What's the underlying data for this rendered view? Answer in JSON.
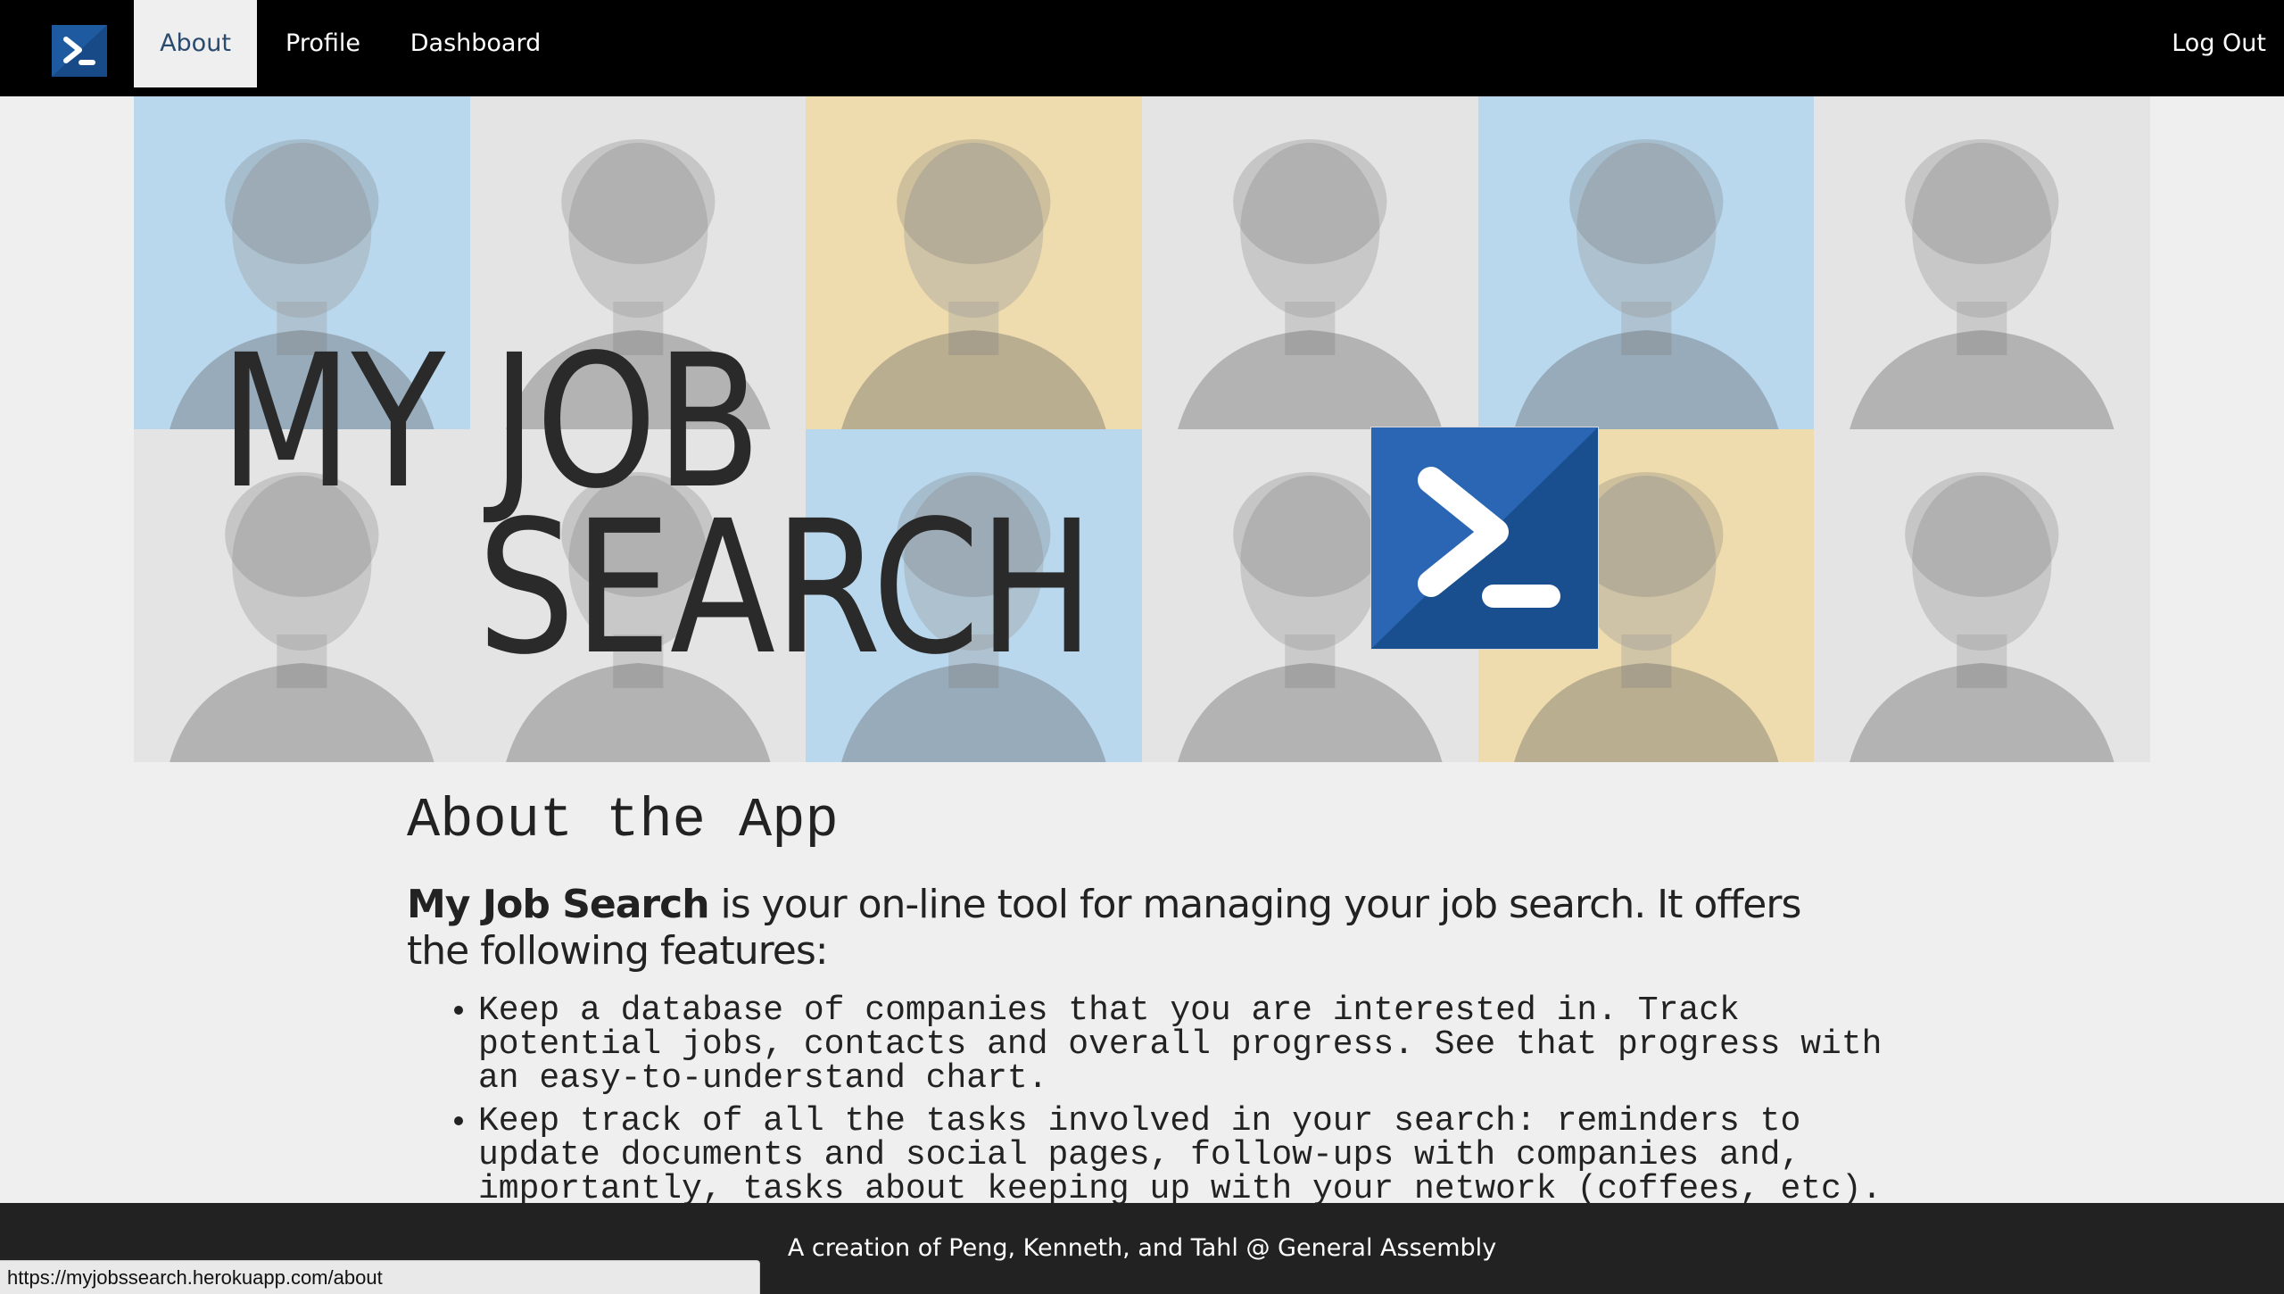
{
  "nav": {
    "about": "About",
    "profile": "Profile",
    "dashboard": "Dashboard",
    "logout": "Log Out",
    "active": "About"
  },
  "hero": {
    "title_line1": "MY  JOB",
    "title_line2": "SEARCH",
    "logo_icon": "powershell-prompt-icon"
  },
  "about": {
    "heading": "About the App",
    "intro_bold": "My Job Search",
    "intro_rest": " is your on-line tool for managing your job search. It offers the following features:",
    "features": [
      "Keep a database of companies that you are interested in. Track potential jobs, contacts and overall progress. See that progress with an easy-to-understand chart.",
      "Keep track of all the tasks involved in your search: reminders to update documents and social pages, follow-ups with companies and, importantly, tasks about keeping up with your network (coffees, etc)."
    ]
  },
  "footer": {
    "credit": "A creation of Peng, Kenneth, and Tahl @ General Assembly"
  },
  "status_bar": {
    "url": "https://myjobssearch.herokuapp.com/about"
  },
  "colors": {
    "navbar": "#000000",
    "page_bg": "#efefef",
    "active_tab_text": "#2a4a6e",
    "logo_blue": "#1e5aa0",
    "tile_blue": "#b9d8ee",
    "tile_beige": "#efdcae",
    "tile_gray": "#e4e4e4",
    "footer": "#222222"
  }
}
